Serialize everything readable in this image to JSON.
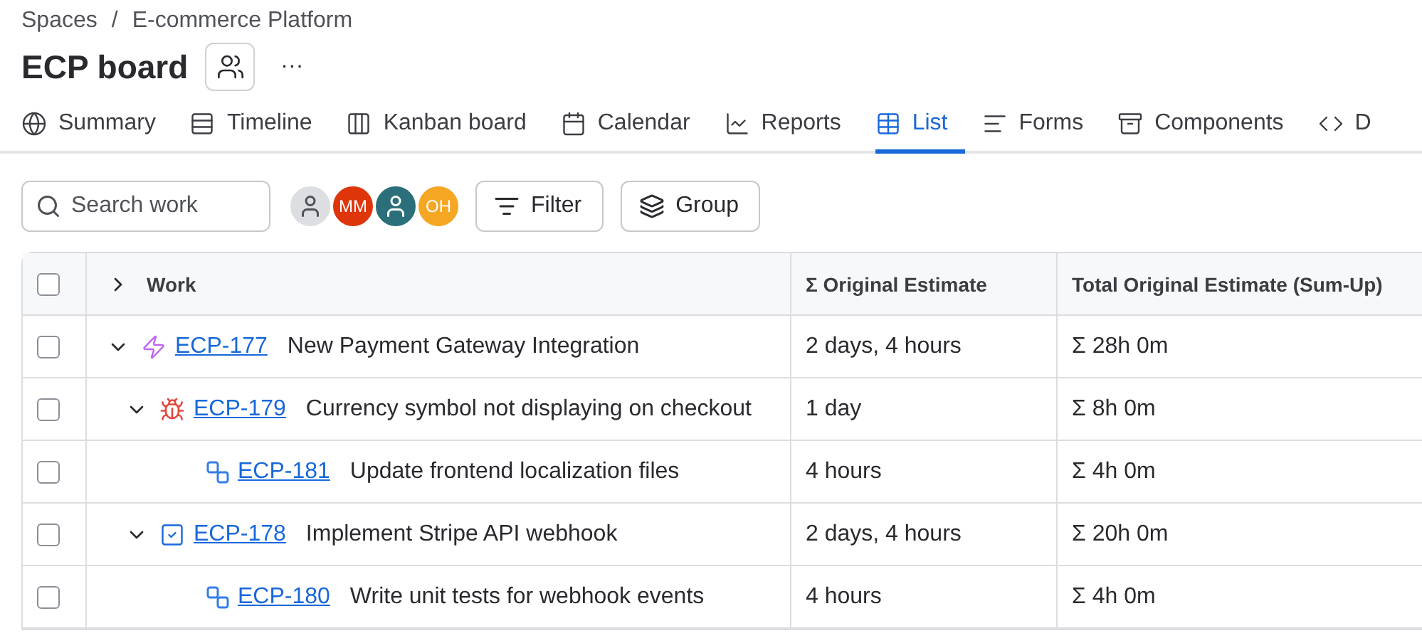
{
  "breadcrumb": [
    "Spaces",
    "E-commerce Platform"
  ],
  "breadcrumb_separator": "/",
  "title": "ECP board",
  "more": "···",
  "tabs": [
    {
      "label": "Summary",
      "selected": false
    },
    {
      "label": "Timeline",
      "selected": false
    },
    {
      "label": "Kanban board",
      "selected": false
    },
    {
      "label": "Calendar",
      "selected": false
    },
    {
      "label": "Reports",
      "selected": false
    },
    {
      "label": "List",
      "selected": true
    },
    {
      "label": "Forms",
      "selected": false
    },
    {
      "label": "Components",
      "selected": false
    },
    {
      "label": "D",
      "selected": false
    }
  ],
  "search": {
    "placeholder": "Search work"
  },
  "avatars": [
    {
      "kind": "unassigned"
    },
    {
      "kind": "initials",
      "initials": "MM",
      "color": "#de350b"
    },
    {
      "kind": "photo",
      "color": "#2a6f7a"
    },
    {
      "kind": "initials",
      "initials": "OH",
      "color": "#f5a623"
    }
  ],
  "filter_button": "Filter",
  "group_button": "Group",
  "table": {
    "select_all_checked": false,
    "expanded": false,
    "columns": [
      "Work",
      "Σ Original Estimate",
      "Total Original Estimate (Sum-Up)"
    ],
    "rows": [
      {
        "kind": "epic",
        "key": "ECP-177",
        "summary": "New Payment Gateway Integration",
        "estimate": "2 days, 4 hours",
        "total": "Σ 28h 0m",
        "checked": false,
        "expanded": true,
        "children": [
          {
            "kind": "bug",
            "key": "ECP-179",
            "summary": "Currency symbol not displaying on checkout",
            "estimate": "1 day",
            "total": "Σ 8h 0m",
            "checked": false,
            "expanded": true,
            "children": [
              {
                "kind": "subtask",
                "key": "ECP-181",
                "summary": "Update frontend localization files",
                "estimate": "4 hours",
                "total": "Σ 4h 0m",
                "checked": false
              }
            ]
          },
          {
            "kind": "task",
            "key": "ECP-178",
            "summary": "Implement Stripe API webhook",
            "estimate": "2 days, 4 hours",
            "total": "Σ 20h 0m",
            "checked": false,
            "expanded": true,
            "children": [
              {
                "kind": "subtask",
                "key": "ECP-180",
                "summary": "Write unit tests for webhook events",
                "estimate": "4 hours",
                "total": "Σ 4h 0m",
                "checked": false
              }
            ]
          }
        ]
      }
    ]
  }
}
